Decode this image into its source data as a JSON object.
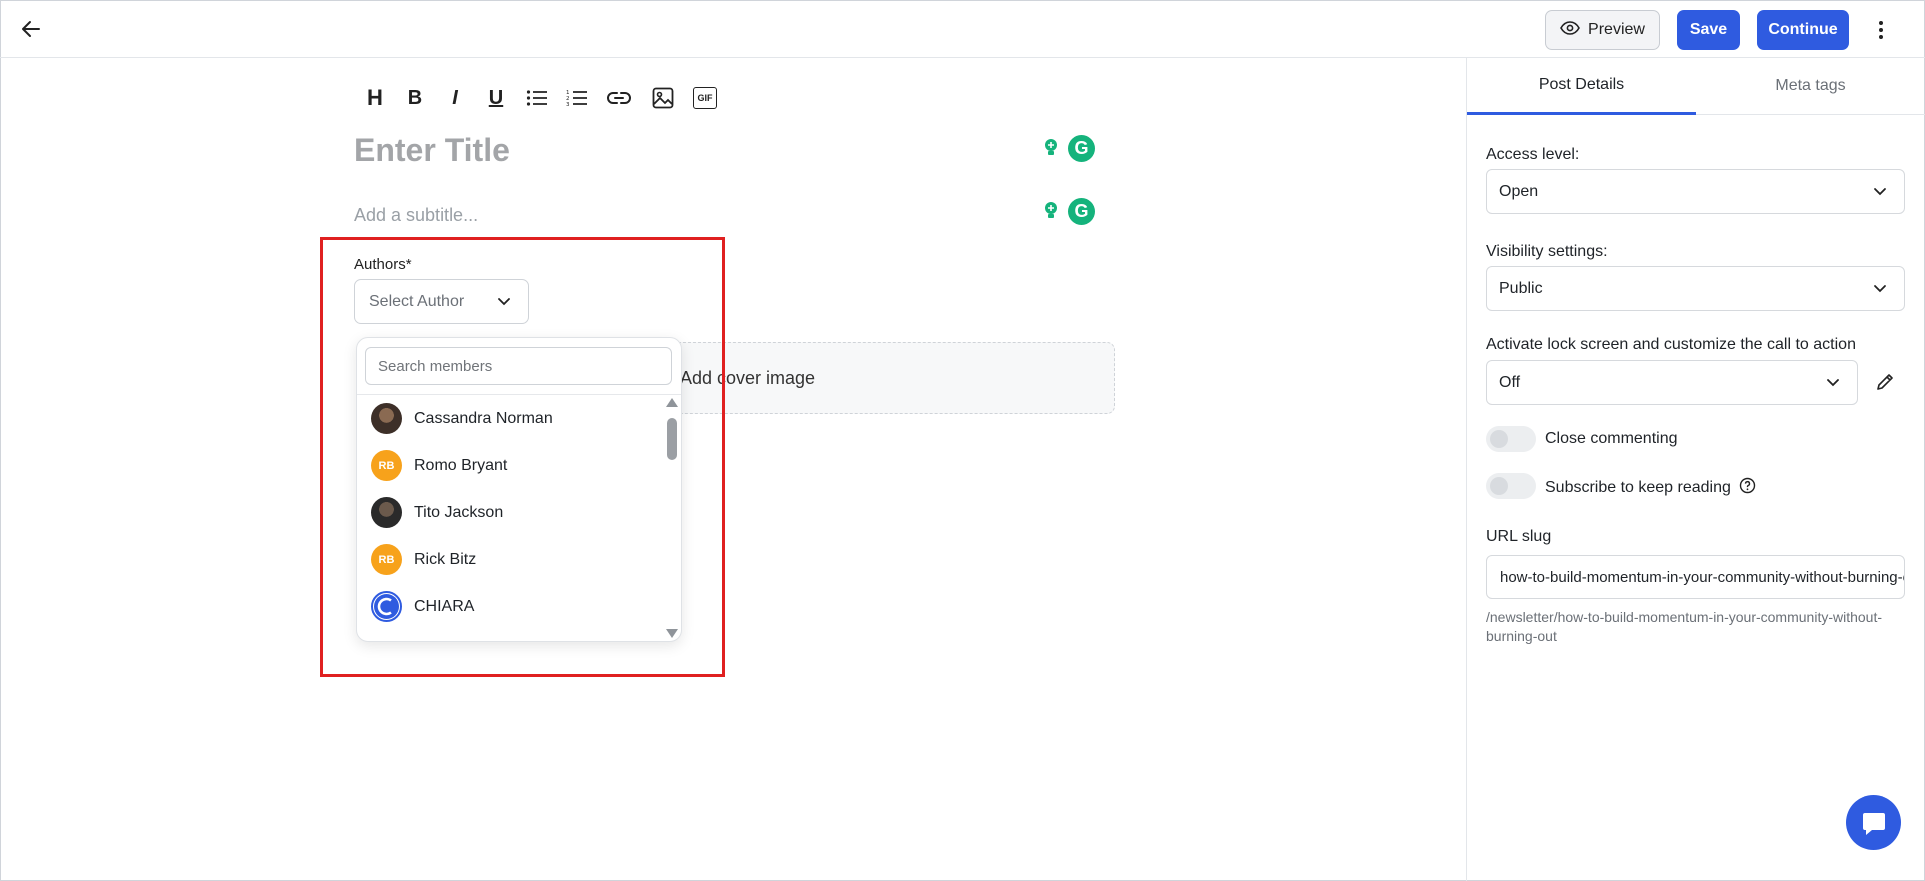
{
  "header": {
    "preview_label": "Preview",
    "save_label": "Save",
    "continue_label": "Continue"
  },
  "editor": {
    "toolbar": {
      "heading": "H",
      "bold": "B",
      "italic": "I",
      "underline": "U",
      "gif": "GIF"
    },
    "title_placeholder": "Enter Title",
    "subtitle_placeholder": "Add a subtitle...",
    "authors_label": "Authors*",
    "author_select_placeholder": "Select Author",
    "cover_label": "Add cover image",
    "grammarly_letter": "G"
  },
  "author_dropdown": {
    "search_placeholder": "Search members",
    "members": [
      {
        "name": "Cassandra Norman",
        "avatar": "photo"
      },
      {
        "name": "Romo Bryant",
        "avatar": "initials",
        "initials": "RB"
      },
      {
        "name": "Tito Jackson",
        "avatar": "photo"
      },
      {
        "name": "Rick Bitz",
        "avatar": "initials",
        "initials": "RB"
      },
      {
        "name": "CHIARA",
        "avatar": "logo"
      }
    ]
  },
  "right_panel": {
    "tabs": [
      "Post Details",
      "Meta tags"
    ],
    "access_level_label": "Access level:",
    "access_level_value": "Open",
    "visibility_label": "Visibility settings:",
    "visibility_value": "Public",
    "lock_screen_label": "Activate lock screen and customize the call to action",
    "lock_screen_value": "Off",
    "close_commenting_label": "Close commenting",
    "close_commenting_on": false,
    "subscribe_label": "Subscribe to keep reading",
    "subscribe_on": false,
    "url_slug_label": "URL slug",
    "url_slug_value": "how-to-build-momentum-in-your-community-without-burning-out",
    "url_path": "/newsletter/how-to-build-momentum-in-your-community-without-burning-out"
  },
  "colors": {
    "primary": "#2f5be0",
    "highlight": "#e02020",
    "avatar_initials": "#f7a21b",
    "grammarly": "#15b37c"
  }
}
